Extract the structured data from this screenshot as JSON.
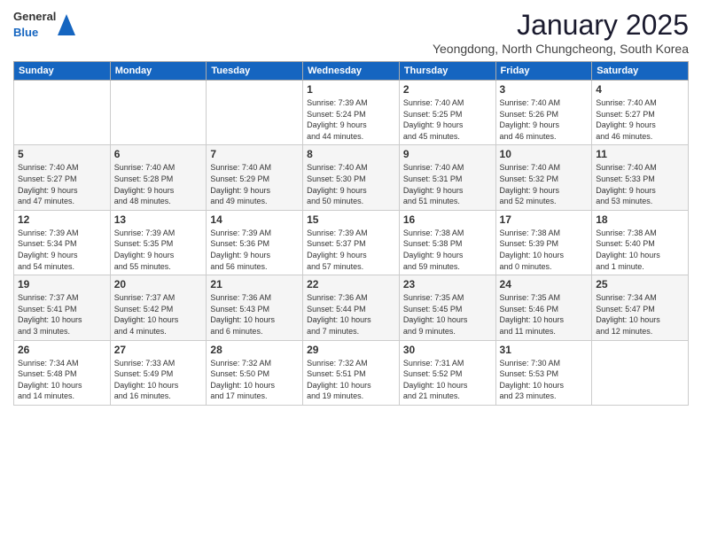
{
  "header": {
    "logo": {
      "general": "General",
      "blue": "Blue"
    },
    "title": "January 2025",
    "subtitle": "Yeongdong, North Chungcheong, South Korea"
  },
  "weekdays": [
    "Sunday",
    "Monday",
    "Tuesday",
    "Wednesday",
    "Thursday",
    "Friday",
    "Saturday"
  ],
  "weeks": [
    [
      {
        "day": "",
        "info": ""
      },
      {
        "day": "",
        "info": ""
      },
      {
        "day": "",
        "info": ""
      },
      {
        "day": "1",
        "info": "Sunrise: 7:39 AM\nSunset: 5:24 PM\nDaylight: 9 hours\nand 44 minutes."
      },
      {
        "day": "2",
        "info": "Sunrise: 7:40 AM\nSunset: 5:25 PM\nDaylight: 9 hours\nand 45 minutes."
      },
      {
        "day": "3",
        "info": "Sunrise: 7:40 AM\nSunset: 5:26 PM\nDaylight: 9 hours\nand 46 minutes."
      },
      {
        "day": "4",
        "info": "Sunrise: 7:40 AM\nSunset: 5:27 PM\nDaylight: 9 hours\nand 46 minutes."
      }
    ],
    [
      {
        "day": "5",
        "info": "Sunrise: 7:40 AM\nSunset: 5:27 PM\nDaylight: 9 hours\nand 47 minutes."
      },
      {
        "day": "6",
        "info": "Sunrise: 7:40 AM\nSunset: 5:28 PM\nDaylight: 9 hours\nand 48 minutes."
      },
      {
        "day": "7",
        "info": "Sunrise: 7:40 AM\nSunset: 5:29 PM\nDaylight: 9 hours\nand 49 minutes."
      },
      {
        "day": "8",
        "info": "Sunrise: 7:40 AM\nSunset: 5:30 PM\nDaylight: 9 hours\nand 50 minutes."
      },
      {
        "day": "9",
        "info": "Sunrise: 7:40 AM\nSunset: 5:31 PM\nDaylight: 9 hours\nand 51 minutes."
      },
      {
        "day": "10",
        "info": "Sunrise: 7:40 AM\nSunset: 5:32 PM\nDaylight: 9 hours\nand 52 minutes."
      },
      {
        "day": "11",
        "info": "Sunrise: 7:40 AM\nSunset: 5:33 PM\nDaylight: 9 hours\nand 53 minutes."
      }
    ],
    [
      {
        "day": "12",
        "info": "Sunrise: 7:39 AM\nSunset: 5:34 PM\nDaylight: 9 hours\nand 54 minutes."
      },
      {
        "day": "13",
        "info": "Sunrise: 7:39 AM\nSunset: 5:35 PM\nDaylight: 9 hours\nand 55 minutes."
      },
      {
        "day": "14",
        "info": "Sunrise: 7:39 AM\nSunset: 5:36 PM\nDaylight: 9 hours\nand 56 minutes."
      },
      {
        "day": "15",
        "info": "Sunrise: 7:39 AM\nSunset: 5:37 PM\nDaylight: 9 hours\nand 57 minutes."
      },
      {
        "day": "16",
        "info": "Sunrise: 7:38 AM\nSunset: 5:38 PM\nDaylight: 9 hours\nand 59 minutes."
      },
      {
        "day": "17",
        "info": "Sunrise: 7:38 AM\nSunset: 5:39 PM\nDaylight: 10 hours\nand 0 minutes."
      },
      {
        "day": "18",
        "info": "Sunrise: 7:38 AM\nSunset: 5:40 PM\nDaylight: 10 hours\nand 1 minute."
      }
    ],
    [
      {
        "day": "19",
        "info": "Sunrise: 7:37 AM\nSunset: 5:41 PM\nDaylight: 10 hours\nand 3 minutes."
      },
      {
        "day": "20",
        "info": "Sunrise: 7:37 AM\nSunset: 5:42 PM\nDaylight: 10 hours\nand 4 minutes."
      },
      {
        "day": "21",
        "info": "Sunrise: 7:36 AM\nSunset: 5:43 PM\nDaylight: 10 hours\nand 6 minutes."
      },
      {
        "day": "22",
        "info": "Sunrise: 7:36 AM\nSunset: 5:44 PM\nDaylight: 10 hours\nand 7 minutes."
      },
      {
        "day": "23",
        "info": "Sunrise: 7:35 AM\nSunset: 5:45 PM\nDaylight: 10 hours\nand 9 minutes."
      },
      {
        "day": "24",
        "info": "Sunrise: 7:35 AM\nSunset: 5:46 PM\nDaylight: 10 hours\nand 11 minutes."
      },
      {
        "day": "25",
        "info": "Sunrise: 7:34 AM\nSunset: 5:47 PM\nDaylight: 10 hours\nand 12 minutes."
      }
    ],
    [
      {
        "day": "26",
        "info": "Sunrise: 7:34 AM\nSunset: 5:48 PM\nDaylight: 10 hours\nand 14 minutes."
      },
      {
        "day": "27",
        "info": "Sunrise: 7:33 AM\nSunset: 5:49 PM\nDaylight: 10 hours\nand 16 minutes."
      },
      {
        "day": "28",
        "info": "Sunrise: 7:32 AM\nSunset: 5:50 PM\nDaylight: 10 hours\nand 17 minutes."
      },
      {
        "day": "29",
        "info": "Sunrise: 7:32 AM\nSunset: 5:51 PM\nDaylight: 10 hours\nand 19 minutes."
      },
      {
        "day": "30",
        "info": "Sunrise: 7:31 AM\nSunset: 5:52 PM\nDaylight: 10 hours\nand 21 minutes."
      },
      {
        "day": "31",
        "info": "Sunrise: 7:30 AM\nSunset: 5:53 PM\nDaylight: 10 hours\nand 23 minutes."
      },
      {
        "day": "",
        "info": ""
      }
    ]
  ],
  "colors": {
    "header_bg": "#1565c0",
    "header_text": "#ffffff",
    "accent": "#1565c0"
  }
}
